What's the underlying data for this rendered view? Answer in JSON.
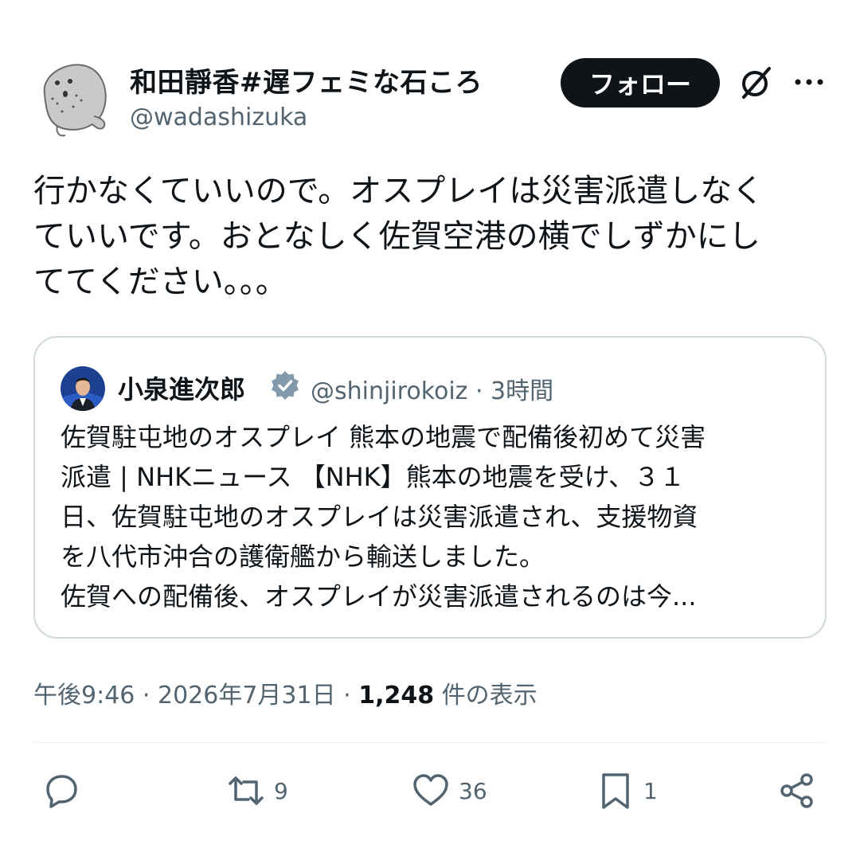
{
  "author": {
    "display_name": "和田靜香#遅フェミな石ころ",
    "handle": "@wadashizuka",
    "avatar_icon": "stone-avatar-icon"
  },
  "follow_label": "フォロー",
  "tweet": {
    "lines": [
      "行かなくていいので。オスプレイは災害派遣しなく",
      "ていいです。おとなしく佐賀空港の横でしずかにし",
      "ててください。。。"
    ]
  },
  "quote": {
    "display_name": "小泉進次郎",
    "handle_time": "@shinjirokoiz · 3時間",
    "lines": [
      "佐賀駐屯地のオスプレイ 熊本の地震で配備後初めて災害",
      "派遣 | NHKニュース 【NHK】熊本の地震を受け、３１",
      "日、佐賀駐屯地のオスプレイは災害派遣され、支援物資",
      "を八代市沖合の護衛艦から輸送しました。",
      "佐賀への配備後、オスプレイが災害派遣されるのは今..."
    ]
  },
  "meta": {
    "time_date": "午後9:46 · 2026年7月31日 · ",
    "views_count": "1,248",
    "views_label": " 件の表示"
  },
  "actions": {
    "retweets": "9",
    "likes": "36",
    "bookmarks": "1"
  },
  "colors": {
    "text": "#0f1419",
    "secondary": "#536471",
    "border": "#cfd9de",
    "verified": "#829aab"
  }
}
